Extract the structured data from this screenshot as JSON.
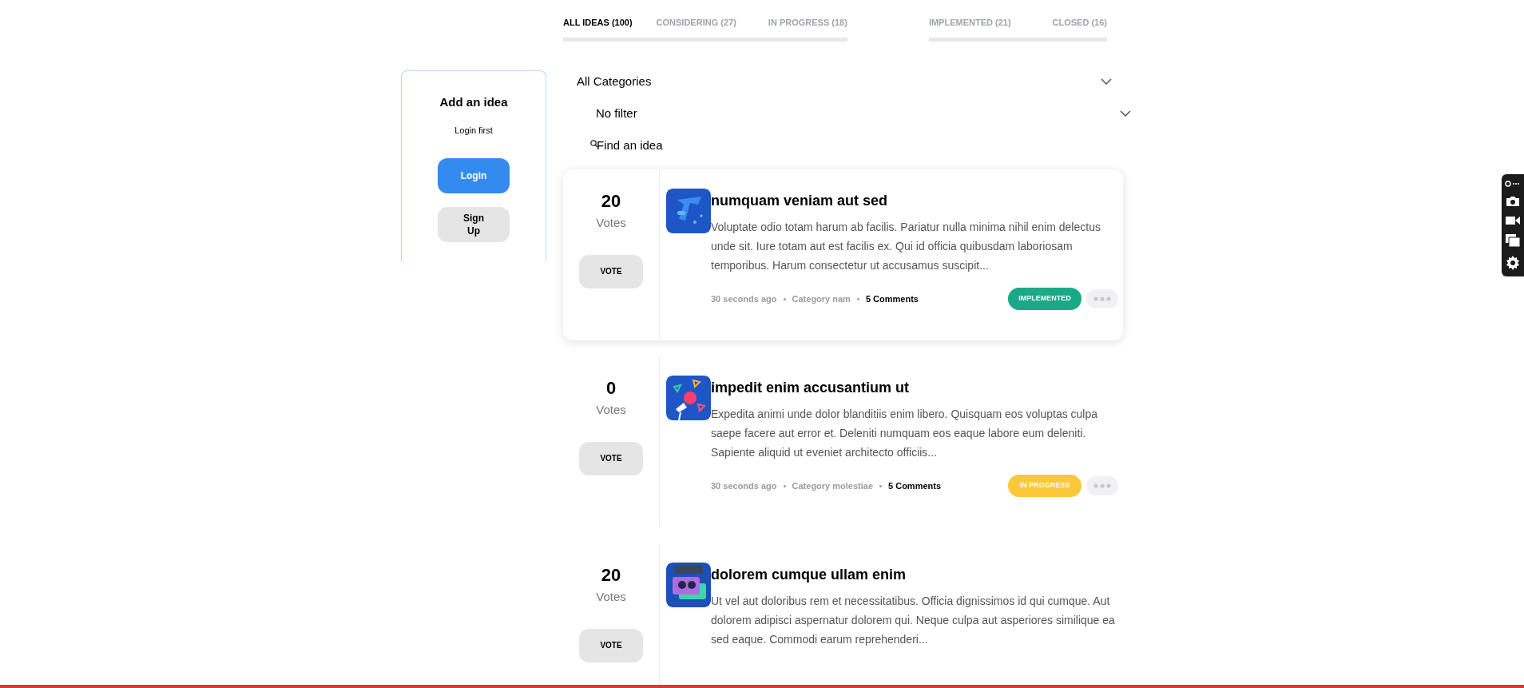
{
  "tabs": [
    {
      "label": "ALL IDEAS (100)",
      "selected": true
    },
    {
      "label": "CONSIDERING (27)",
      "selected": false
    },
    {
      "label": "IN PROGRESS (18)",
      "selected": false
    },
    {
      "label": "IMPLEMENTED (21)",
      "selected": false
    },
    {
      "label": "CLOSED (16)",
      "selected": false
    }
  ],
  "add_idea": {
    "title": "Add an idea",
    "note": "Login first",
    "login_button": "Login",
    "signup_button": "Sign Up"
  },
  "filters": {
    "category": "All Categories",
    "status": "No filter",
    "search_placeholder": "Find an idea"
  },
  "ideas": [
    {
      "votes": "20",
      "votes_label": "Votes",
      "vote_button": "VOTE",
      "title": "numquam veniam aut sed",
      "body": "Voluptate odio totam harum ab facilis. Pariatur nulla minima nihil enim delectus unde sit. Iure totam aut est facilis ex. Qui id officia quibusdam laboriosam temporibus. Harum consectetur ut accusamus suscipit...",
      "time": "30 seconds ago",
      "category": "Category nam",
      "comments": "5 Comments",
      "status": {
        "label": "IMPLEMENTED",
        "kind": "implemented"
      },
      "hovered": true
    },
    {
      "votes": "0",
      "votes_label": "Votes",
      "vote_button": "VOTE",
      "title": "impedit enim accusantium ut",
      "body": "Expedita animi unde dolor blanditiis enim libero. Quisquam eos voluptas culpa saepe facere aut error et. Deleniti numquam eos eaque labore eum deleniti. Sapiente aliquid ut eveniet architecto officiis...",
      "time": "30 seconds ago",
      "category": "Category molestiae",
      "comments": "5 Comments",
      "status": {
        "label": "IN PROGRESS",
        "kind": "in_progress"
      },
      "hovered": false
    },
    {
      "votes": "20",
      "votes_label": "Votes",
      "vote_button": "VOTE",
      "title": "dolorem cumque ullam enim",
      "body": "Ut vel aut doloribus rem et necessitatibus. Officia dignissimos id qui cumque. Aut dolorem adipisci aspernatur dolorem qui. Neque culpa aut asperiores similique ea sed eaque. Commodi earum reprehenderi...",
      "hovered": false
    }
  ]
}
